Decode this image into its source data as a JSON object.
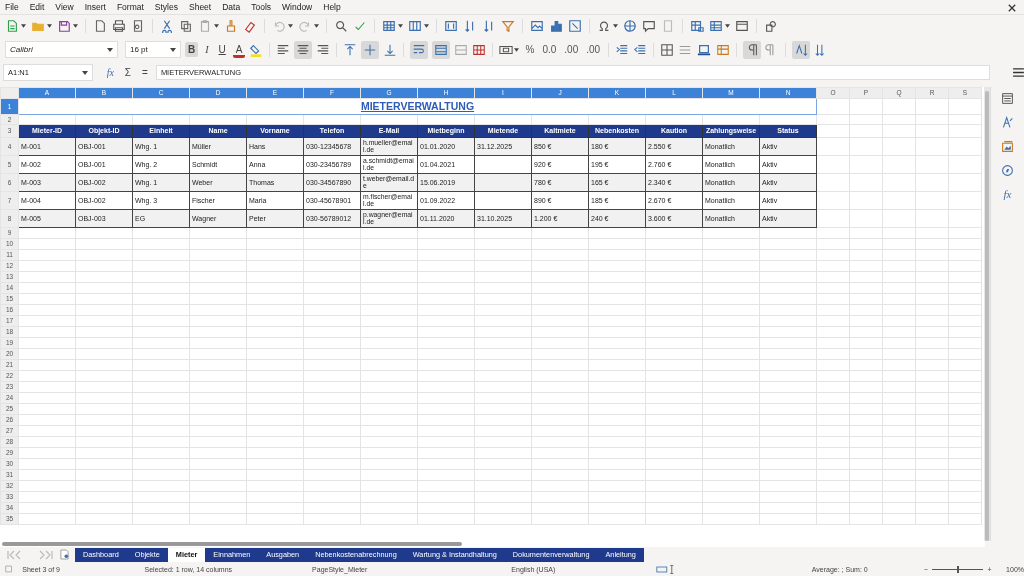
{
  "menu": [
    "File",
    "Edit",
    "View",
    "Insert",
    "Format",
    "Styles",
    "Sheet",
    "Data",
    "Tools",
    "Window",
    "Help"
  ],
  "font_name": "Calibri",
  "font_size": "16 pt",
  "style_buttons": [
    {
      "label": "B",
      "selected": true
    },
    {
      "label": "I",
      "selected": false
    },
    {
      "label": "U",
      "selected": false
    }
  ],
  "font_color_label": "A",
  "toggles": {
    "align_center": true,
    "vertical_center": true,
    "wrap_text": true,
    "merge_cells": true,
    "left_to_right": true,
    "vertical_text": true
  },
  "number_buttons": [
    "%",
    "0.0",
    ".00",
    ".00"
  ],
  "name_box": "A1:N1",
  "function_label": "fx",
  "side_function_label": "fx",
  "sum_label": "Σ",
  "equals_label": "=",
  "formula": "MIETERVERWALTUNG",
  "column_headers": [
    {
      "label": "A",
      "selected": true
    },
    {
      "label": "B",
      "selected": true
    },
    {
      "label": "C",
      "selected": true
    },
    {
      "label": "D",
      "selected": true
    },
    {
      "label": "E",
      "selected": true
    },
    {
      "label": "F",
      "selected": true
    },
    {
      "label": "G",
      "selected": true
    },
    {
      "label": "H",
      "selected": true
    },
    {
      "label": "I",
      "selected": true
    },
    {
      "label": "J",
      "selected": true
    },
    {
      "label": "K",
      "selected": true
    },
    {
      "label": "L",
      "selected": true
    },
    {
      "label": "M",
      "selected": true
    },
    {
      "label": "N",
      "selected": true
    },
    {
      "label": "O",
      "selected": false
    },
    {
      "label": "P",
      "selected": false
    },
    {
      "label": "Q",
      "selected": false
    },
    {
      "label": "R",
      "selected": false
    },
    {
      "label": "S",
      "selected": false
    }
  ],
  "row_headers": [
    {
      "label": "1",
      "selected": true
    },
    {
      "label": "2",
      "selected": false
    },
    {
      "label": "3",
      "selected": false
    },
    {
      "label": "4",
      "selected": false
    },
    {
      "label": "5",
      "selected": false
    },
    {
      "label": "6",
      "selected": false
    },
    {
      "label": "7",
      "selected": false
    },
    {
      "label": "8",
      "selected": false
    },
    {
      "label": "9",
      "selected": false
    },
    {
      "label": "10",
      "selected": false
    },
    {
      "label": "11",
      "selected": false
    },
    {
      "label": "12",
      "selected": false
    },
    {
      "label": "13",
      "selected": false
    },
    {
      "label": "14",
      "selected": false
    },
    {
      "label": "15",
      "selected": false
    },
    {
      "label": "16",
      "selected": false
    },
    {
      "label": "17",
      "selected": false
    },
    {
      "label": "18",
      "selected": false
    },
    {
      "label": "19",
      "selected": false
    },
    {
      "label": "20",
      "selected": false
    },
    {
      "label": "21",
      "selected": false
    },
    {
      "label": "22",
      "selected": false
    },
    {
      "label": "23",
      "selected": false
    },
    {
      "label": "24",
      "selected": false
    },
    {
      "label": "25",
      "selected": false
    },
    {
      "label": "26",
      "selected": false
    },
    {
      "label": "27",
      "selected": false
    },
    {
      "label": "28",
      "selected": false
    },
    {
      "label": "29",
      "selected": false
    },
    {
      "label": "30",
      "selected": false
    },
    {
      "label": "31",
      "selected": false
    },
    {
      "label": "32",
      "selected": false
    },
    {
      "label": "33",
      "selected": false
    },
    {
      "label": "34",
      "selected": false
    },
    {
      "label": "35",
      "selected": false
    }
  ],
  "title": "MIETERVERWALTUNG",
  "table": {
    "columns": [
      "Mieter-ID",
      "Objekt-ID",
      "Einheit",
      "Name",
      "Vorname",
      "Telefon",
      "E-Mail",
      "Mietbeginn",
      "Mietende",
      "Kaltmiete",
      "Nebenkosten",
      "Kaution",
      "Zahlungsweise",
      "Status"
    ],
    "rows": [
      [
        "M-001",
        "OBJ-001",
        "Whg. 1",
        "Müller",
        "Hans",
        "030-12345678",
        "h.mueller@email.de",
        "01.01.2020",
        "31.12.2025",
        "850 €",
        "180 €",
        "2.550 €",
        "Monatlich",
        "Aktiv"
      ],
      [
        "M-002",
        "OBJ-001",
        "Whg. 2",
        "Schmidt",
        "Anna",
        "030-23456789",
        "a.schmidt@email.de",
        "01.04.2021",
        "",
        "920 €",
        "195 €",
        "2.760 €",
        "Monatlich",
        "Aktiv"
      ],
      [
        "M-003",
        "OBJ-002",
        "Whg. 1",
        "Weber",
        "Thomas",
        "030-34567890",
        "t.weber@email.de",
        "15.06.2019",
        "",
        "780 €",
        "165 €",
        "2.340 €",
        "Monatlich",
        "Aktiv"
      ],
      [
        "M-004",
        "OBJ-002",
        "Whg. 3",
        "Fischer",
        "Maria",
        "030-45678901",
        "m.fischer@email.de",
        "01.09.2022",
        "",
        "890 €",
        "185 €",
        "2.670 €",
        "Monatlich",
        "Aktiv"
      ],
      [
        "M-005",
        "OBJ-003",
        "EG",
        "Wagner",
        "Peter",
        "030-56789012",
        "p.wagner@email.de",
        "01.11.2020",
        "31.10.2025",
        "1.200 €",
        "240 €",
        "3.600 €",
        "Monatlich",
        "Aktiv"
      ]
    ]
  },
  "sheet_tabs": [
    {
      "label": "Dashboard",
      "selected": false
    },
    {
      "label": "Objekte",
      "selected": false
    },
    {
      "label": "Mieter",
      "selected": true
    },
    {
      "label": "Einnahmen",
      "selected": false
    },
    {
      "label": "Ausgaben",
      "selected": false
    },
    {
      "label": "Nebenkostenabrechnung",
      "selected": false
    },
    {
      "label": "Wartung & Instandhaltung",
      "selected": false
    },
    {
      "label": "Dokumentenverwaltung",
      "selected": false
    },
    {
      "label": "Anleitung",
      "selected": false
    }
  ],
  "status_bar": {
    "sheet": "Sheet 3 of 9",
    "selection": "Selected: 1 row, 14 columns",
    "page_style": "PageStyle_Mieter",
    "language": "English (USA)",
    "summary": "Average: ; Sum: 0",
    "zoom_out": "−",
    "zoom_in": "+",
    "zoom_slider": {
      "level": 0.5
    },
    "zoom": "100%"
  }
}
